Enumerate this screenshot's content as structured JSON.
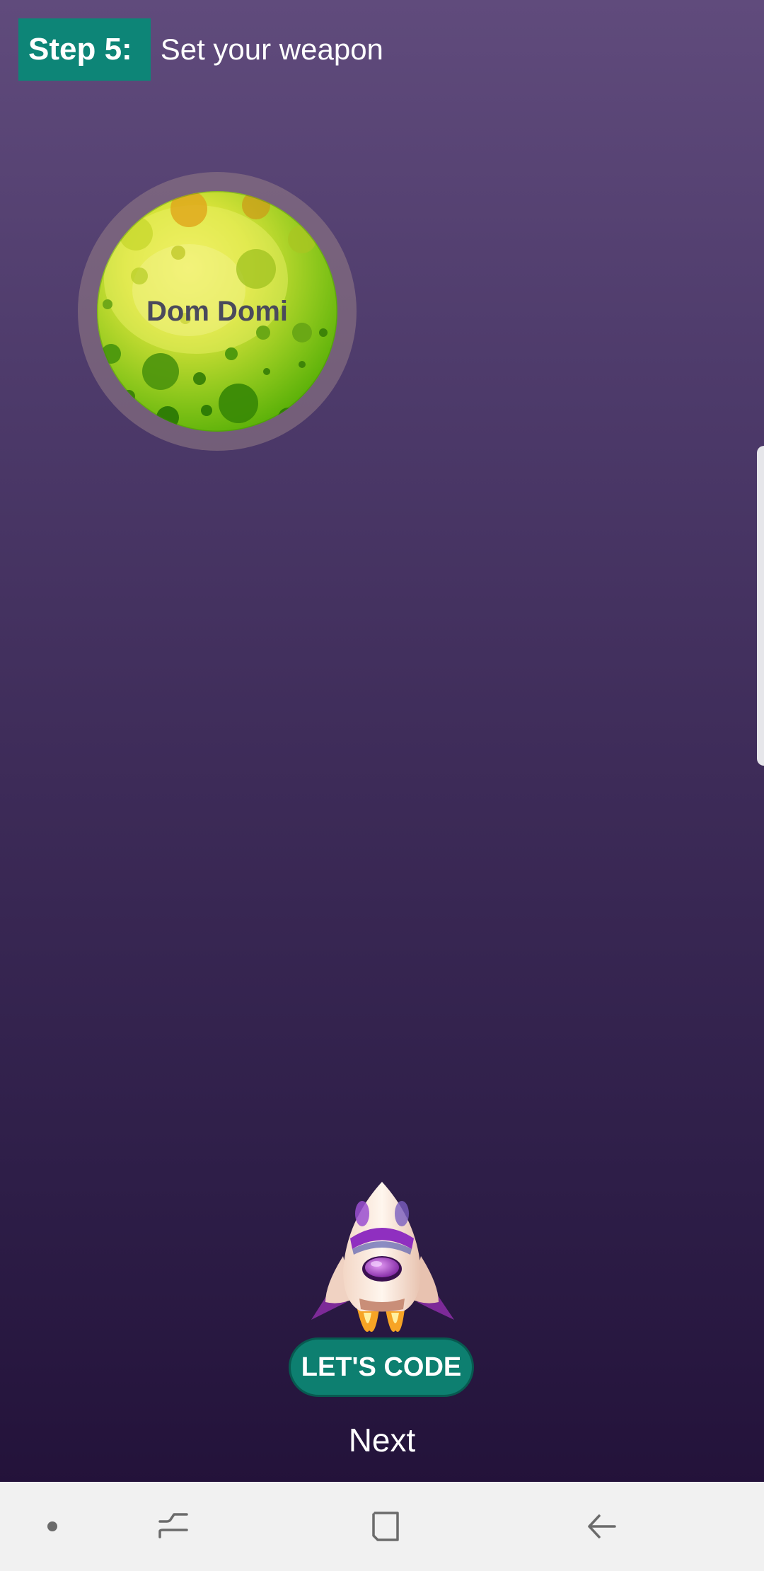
{
  "header": {
    "step_label": "Step 5:",
    "title": "Set your weapon"
  },
  "planet": {
    "name": "Dom Domi"
  },
  "buttons": {
    "lets_code": "LET'S CODE",
    "next": "Next"
  },
  "navbar": {
    "items": [
      "dot-icon",
      "recent-apps-icon",
      "home-icon",
      "back-icon"
    ]
  },
  "colors": {
    "accent": "#0d8577",
    "background_top": "#604b7c",
    "background_bottom": "#200f36"
  }
}
